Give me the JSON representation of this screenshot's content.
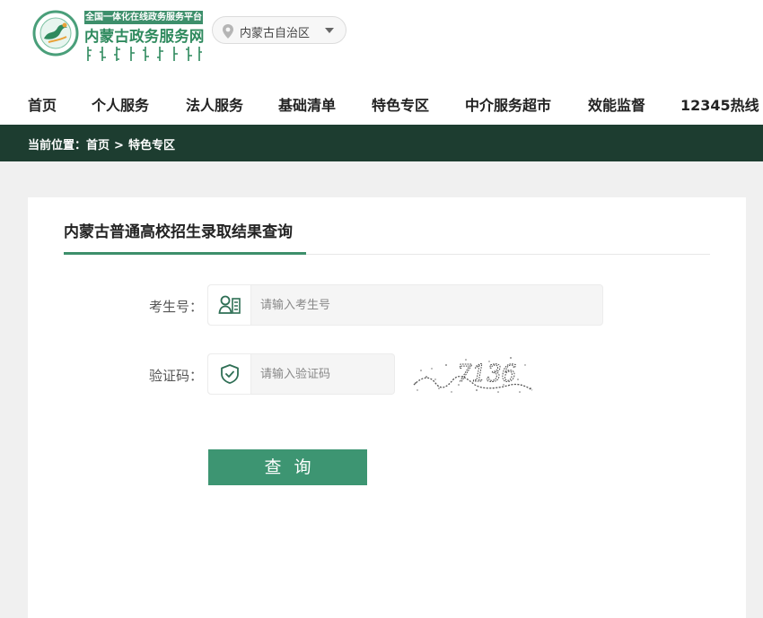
{
  "header": {
    "logo_tag": "全国一体化在线政务服务平台",
    "logo_title": "内蒙古政务服务网",
    "region": "内蒙古自治区"
  },
  "nav": {
    "items": [
      "首页",
      "个人服务",
      "法人服务",
      "基础清单",
      "特色专区",
      "中介服务超市",
      "效能监督",
      "12345热线"
    ]
  },
  "breadcrumb": {
    "prefix": "当前位置：",
    "home": "首页",
    "separator": ">",
    "current": "特色专区"
  },
  "form": {
    "title": "内蒙古普通高校招生录取结果查询",
    "exam_no_label": "考生号：",
    "exam_no_placeholder": "请输入考生号",
    "exam_no_value": "",
    "captcha_label": "验证码：",
    "captcha_placeholder": "请输入验证码",
    "captcha_value": "",
    "captcha_text": "7136",
    "submit_label": "查询"
  },
  "icons": {
    "location": "pin-icon",
    "dropdown": "caret-down-icon",
    "exam_no": "id-card-icon",
    "captcha": "shield-check-icon"
  },
  "colors": {
    "brand_green": "#3d8f6b",
    "breadcrumb_bg": "#1d3d30",
    "button": "#3d9572"
  }
}
